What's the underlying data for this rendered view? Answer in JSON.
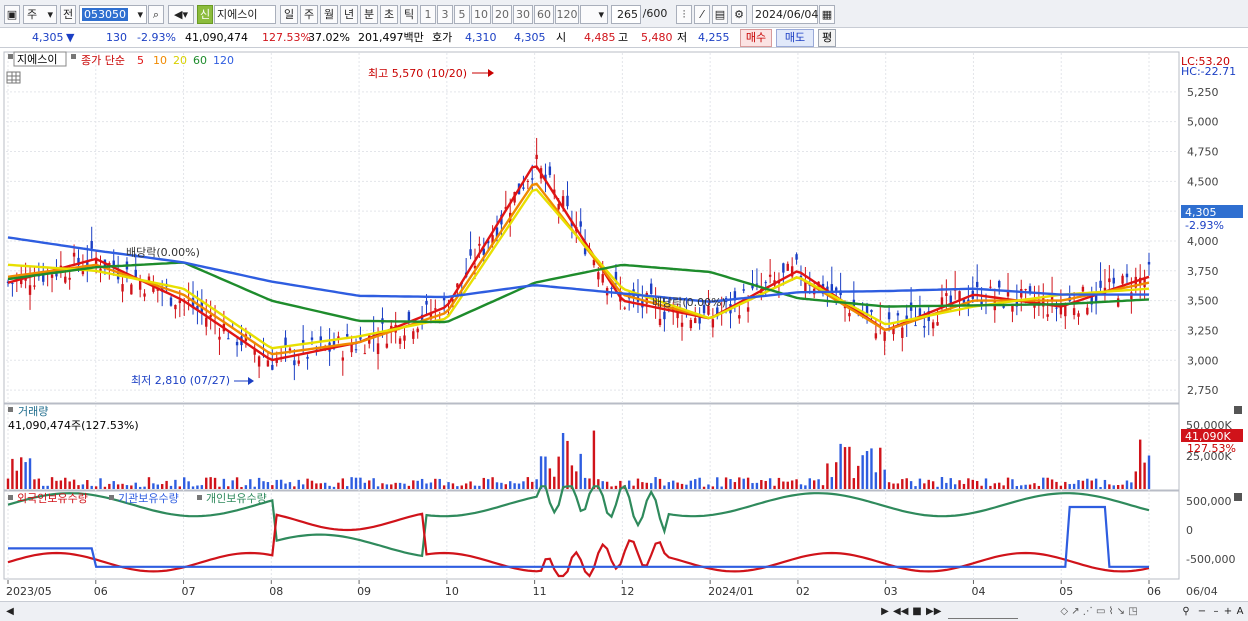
{
  "toolbar": {
    "period_select": "주",
    "prev_button": "전",
    "code": "053050",
    "badge": "신",
    "stock_name": "지에스이",
    "tabs": [
      "일",
      "주",
      "월",
      "년",
      "분",
      "초",
      "틱"
    ],
    "active_tab": "일",
    "intervals": [
      "1",
      "3",
      "5",
      "10",
      "20",
      "30",
      "60",
      "120"
    ],
    "count": "265",
    "count_total": "/600",
    "date": "2024/06/04"
  },
  "infobar": {
    "price": "4,305",
    "arrow": "▼",
    "change": "130",
    "change_pct": "-2.93%",
    "volume": "41,090,474",
    "volume_pct": "127.53%",
    "rate": "37.02%",
    "amount": "201,497백만",
    "ask_label": "호가",
    "ask1": "4,310",
    "ask2": "4,305",
    "open_label": "시",
    "open": "4,485",
    "high_label": "고",
    "high": "5,480",
    "low_label": "저",
    "low": "4,255",
    "buy_button": "매수",
    "sell_button": "매도",
    "eval_button": "평"
  },
  "price_panel": {
    "stock_label": "지에스이",
    "ma_label": "종가 단순",
    "ma_periods": [
      {
        "label": "5",
        "color": "#e01414"
      },
      {
        "label": "10",
        "color": "#f08a00"
      },
      {
        "label": "20",
        "color": "#e8e000"
      },
      {
        "label": "60",
        "color": "#1e8c2c"
      },
      {
        "label": "120",
        "color": "#2e5de0"
      }
    ],
    "lc": "LC:53.20",
    "hc": "HC:-22.71",
    "high_annotation": "최고 5,570 (10/20)",
    "low_annotation": "최저 2,810 (07/27)",
    "dividend_1": "배당락(0.00%)",
    "dividend_2": "배당락(0.00%)",
    "current_price": "4,305",
    "current_pct": "-2.93%",
    "y_ticks": [
      "5,250",
      "5,000",
      "4,750",
      "4,500",
      "4,250",
      "4,000",
      "3,750",
      "3,500",
      "3,250",
      "3,000",
      "2,750"
    ]
  },
  "volume_panel": {
    "title": "거래량",
    "value": "41,090,474주(127.53%)",
    "y_ticks": [
      "50,000K",
      "25,000K"
    ],
    "current": "41,090K",
    "current_pct": "127.53%"
  },
  "holding_panel": {
    "series": [
      {
        "name": "외국인보유수량",
        "color": "#d0131a"
      },
      {
        "name": "기관보유수량",
        "color": "#2e5de0"
      },
      {
        "name": "개인보유수량",
        "color": "#2f8a5c"
      }
    ],
    "y_ticks": [
      "500,000",
      "0",
      "-500,000"
    ]
  },
  "x_axis": {
    "labels": [
      "2023/05",
      "06",
      "07",
      "08",
      "09",
      "10",
      "11",
      "12",
      "2024/01",
      "02",
      "03",
      "04",
      "05",
      "06"
    ],
    "end_label": "06/04"
  },
  "chart_data": {
    "type": "line",
    "title": "",
    "xlabel": "",
    "ylabel": "",
    "x": [
      "2023/05",
      "06",
      "07",
      "08",
      "09",
      "10",
      "11",
      "12",
      "2024/01",
      "02",
      "03",
      "04",
      "05",
      "06"
    ],
    "ylim": [
      2650,
      5450
    ],
    "series": [
      {
        "name": "5",
        "color": "#e01414",
        "values": [
          3650,
          3850,
          3500,
          3000,
          3150,
          3450,
          4650,
          3500,
          3350,
          3750,
          3250,
          3550,
          3450,
          3700
        ]
      },
      {
        "name": "10",
        "color": "#f08a00",
        "values": [
          3700,
          3800,
          3550,
          3050,
          3150,
          3400,
          4500,
          3550,
          3350,
          3700,
          3250,
          3500,
          3500,
          3650
        ]
      },
      {
        "name": "20",
        "color": "#e8e000",
        "values": [
          3800,
          3750,
          3600,
          3100,
          3200,
          3350,
          4450,
          3600,
          3350,
          3700,
          3300,
          3450,
          3550,
          3600
        ]
      },
      {
        "name": "60",
        "color": "#1e8c2c",
        "values": [
          3680,
          3780,
          3820,
          3500,
          3330,
          3320,
          3650,
          3800,
          3740,
          3520,
          3450,
          3460,
          3470,
          3510
        ]
      },
      {
        "name": "120",
        "color": "#2e5de0",
        "values": [
          4030,
          3920,
          3820,
          3660,
          3540,
          3530,
          3630,
          3560,
          3490,
          3570,
          3580,
          3600,
          3550,
          3550
        ]
      }
    ],
    "annotations": [
      {
        "text": "최고 5,570 (10/20)",
        "value": 5570
      },
      {
        "text": "최저 2,810 (07/27)",
        "value": 2810
      }
    ]
  }
}
